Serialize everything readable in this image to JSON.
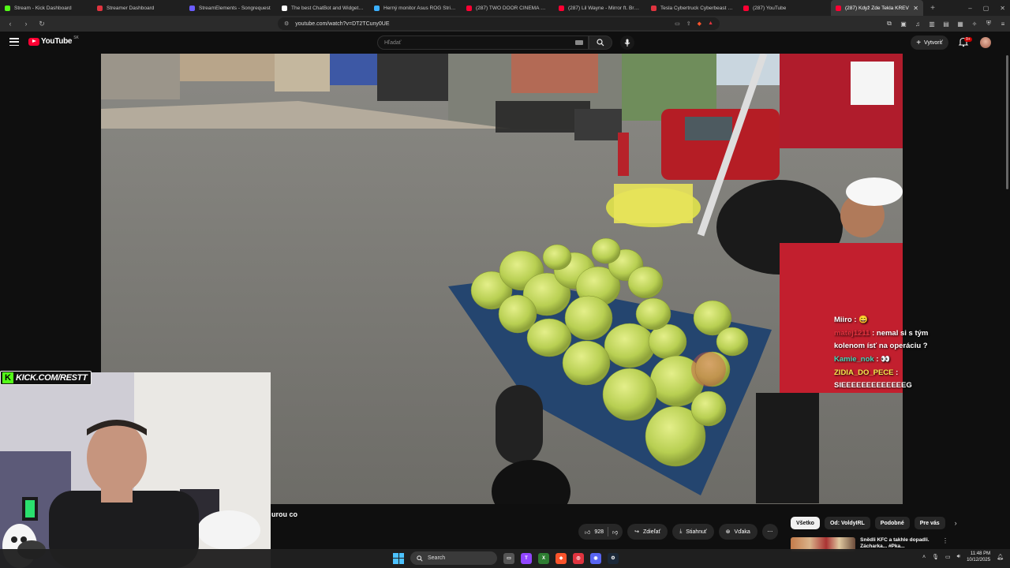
{
  "browser": {
    "tabs": [
      {
        "label": "Stream - Kick Dashboard",
        "color": "#53fc18",
        "active": false
      },
      {
        "label": "Streamer Dashboard",
        "color": "#e0343f",
        "active": false
      },
      {
        "label": "StreamElements - Songrequest",
        "color": "#6b5cff",
        "active": false
      },
      {
        "label": "The best ChatBot and Widgets for",
        "color": "#ffffff",
        "active": false
      },
      {
        "label": "Herný monitor Asus ROG Strix OLI",
        "color": "#3bb0ff",
        "active": false
      },
      {
        "label": "(287) TWO DOOR CINEMA CLUB |",
        "color": "#ff0033",
        "active": false
      },
      {
        "label": "(287) Lil Wayne - Mirror ft. Bruno",
        "color": "#ff0033",
        "active": false
      },
      {
        "label": "Tesla Cybertruck Cyberbeast Electr",
        "color": "#e0343f",
        "active": false
      },
      {
        "label": "(287) YouTube",
        "color": "#ff0033",
        "active": false
      },
      {
        "label": "(287) Když Zde Tekla KREV",
        "color": "#ff0033",
        "active": true
      }
    ],
    "url": "youtube.com/watch?v=DT2TCuny0UE"
  },
  "youtube": {
    "logo_text": "YouTube",
    "country": "SK",
    "search_placeholder": "Hľadať",
    "create_label": "Vytvoriť",
    "notif_count": "9+"
  },
  "overlay": {
    "kick_url": "KICK.COM/RESTT"
  },
  "chat": [
    {
      "name": "Miiro",
      "sep": " :",
      "text": " 😄",
      "name_class": "name1"
    },
    {
      "name": "matej1211",
      "sep": " :",
      "text": " nemal si s tým kolenom ísť na operáciu ?",
      "name_class": "name2"
    },
    {
      "name": "Kamie_nok",
      "sep": " :",
      "text": " 👀",
      "name_class": "name3"
    },
    {
      "name": "ZIDIA_DO_PECE",
      "sep": " :",
      "text": " SIEEEEEEEEEEEEEG",
      "name_class": "name4"
    }
  ],
  "video": {
    "title_fragment": "urou co",
    "like_count": "928",
    "share_label": "Zdieľať",
    "download_label": "Stiahnuť",
    "thanks_label": "Vďaka"
  },
  "chips": [
    "Všetko",
    "Od: VoldyIRL",
    "Podobné",
    "Pre vás"
  ],
  "recommendation": {
    "title": "Snědli KFC a takhle dopadli. Zácharka... #Pka..."
  },
  "taskbar": {
    "search_label": "Search",
    "time": "11:48 PM",
    "date": "10/12/2025"
  }
}
